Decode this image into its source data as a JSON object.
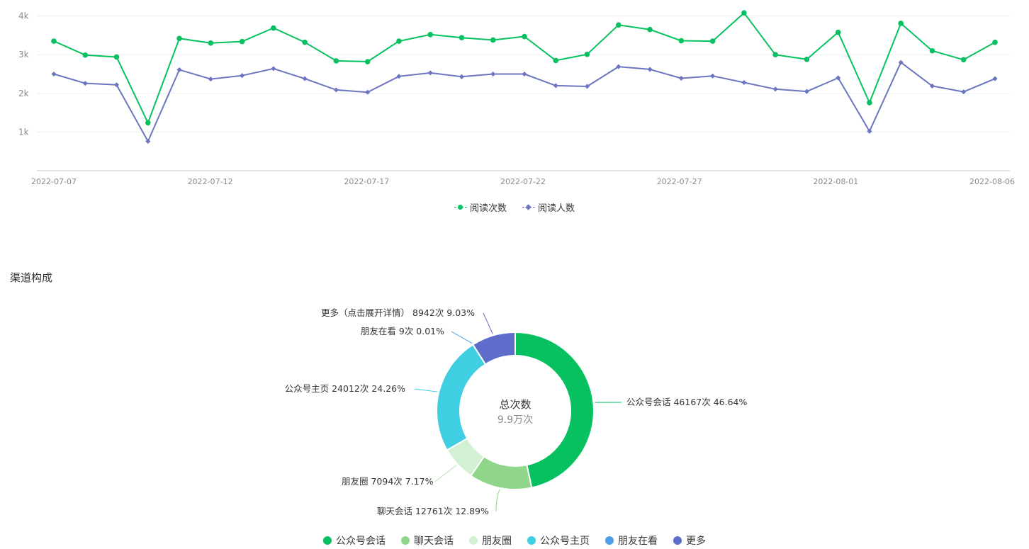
{
  "section_title": "渠道构成",
  "chart_data": [
    {
      "type": "line",
      "x": [
        "2022-07-07",
        "2022-07-08",
        "2022-07-09",
        "2022-07-10",
        "2022-07-11",
        "2022-07-12",
        "2022-07-13",
        "2022-07-14",
        "2022-07-15",
        "2022-07-16",
        "2022-07-17",
        "2022-07-18",
        "2022-07-19",
        "2022-07-20",
        "2022-07-21",
        "2022-07-22",
        "2022-07-23",
        "2022-07-24",
        "2022-07-25",
        "2022-07-26",
        "2022-07-27",
        "2022-07-28",
        "2022-07-29",
        "2022-07-30",
        "2022-07-31",
        "2022-08-01",
        "2022-08-02",
        "2022-08-03",
        "2022-08-04",
        "2022-08-05",
        "2022-08-06"
      ],
      "x_tick_labels": [
        "2022-07-07",
        "2022-07-12",
        "2022-07-17",
        "2022-07-22",
        "2022-07-27",
        "2022-08-01",
        "2022-08-06"
      ],
      "y_tick_labels": [
        "1k",
        "2k",
        "3k",
        "4k"
      ],
      "ylim": [
        0,
        4000
      ],
      "grid": true,
      "legend_position": "bottom-center",
      "series": [
        {
          "name": "阅读次数",
          "color": "#07c160",
          "marker": "circle",
          "values": [
            3350,
            2990,
            2940,
            1240,
            3420,
            3300,
            3340,
            3690,
            3320,
            2840,
            2820,
            3350,
            3520,
            3440,
            3380,
            3470,
            2850,
            3010,
            3770,
            3650,
            3360,
            3350,
            4080,
            3000,
            2880,
            3580,
            1760,
            3810,
            3100,
            2870,
            3320
          ]
        },
        {
          "name": "阅读人数",
          "color": "#6c75bf",
          "marker": "diamond",
          "values": [
            2500,
            2260,
            2220,
            760,
            2610,
            2370,
            2460,
            2640,
            2380,
            2090,
            2030,
            2440,
            2530,
            2430,
            2500,
            2500,
            2200,
            2180,
            2690,
            2620,
            2390,
            2450,
            2280,
            2110,
            2050,
            2400,
            1020,
            2800,
            2190,
            2040,
            2380
          ]
        }
      ]
    },
    {
      "type": "pie",
      "donut": true,
      "center_title": "总次数",
      "center_value": "9.9万次",
      "legend_position": "bottom-center",
      "slices": [
        {
          "name": "公众号会话",
          "value": 46167,
          "label": "公众号会话 46167次 46.64%",
          "color": "#07c160"
        },
        {
          "name": "聊天会话",
          "value": 12761,
          "label": "聊天会话 12761次 12.89%",
          "color": "#8fd68a"
        },
        {
          "name": "朋友圈",
          "value": 7094,
          "label": "朋友圈 7094次 7.17%",
          "color": "#d3f0d3"
        },
        {
          "name": "公众号主页",
          "value": 24012,
          "label": "公众号主页 24012次 24.26%",
          "color": "#40cee3"
        },
        {
          "name": "朋友在看",
          "value": 9,
          "label": "朋友在看 9次 0.01%",
          "color": "#4c9ee8"
        },
        {
          "name": "更多",
          "value": 8942,
          "label": "更多（点击展开详情） 8942次 9.03%",
          "color": "#5e6cca"
        }
      ]
    }
  ]
}
